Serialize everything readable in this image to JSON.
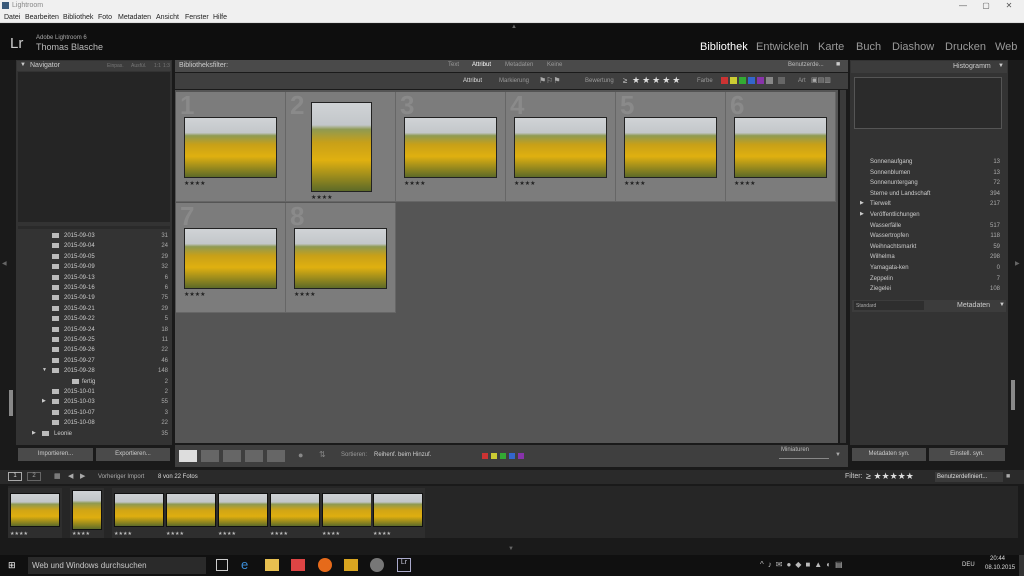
{
  "window": {
    "title": "Lightroom",
    "minimize": "—",
    "maximize": "▢",
    "close": "✕"
  },
  "menu": [
    "Datei",
    "Bearbeiten",
    "Bibliothek",
    "Foto",
    "Metadaten",
    "Ansicht",
    "Fenster",
    "Hilfe"
  ],
  "identity": {
    "product": "Adobe Lightroom 6",
    "user": "Thomas Blasche",
    "logo": "Lr"
  },
  "modules": [
    "Bibliothek",
    "Entwickeln",
    "Karte",
    "Buch",
    "Diashow",
    "Drucken",
    "Web"
  ],
  "navigator": {
    "title": "Navigator",
    "options": [
      "Einpas.",
      "Ausfül.",
      "1:1",
      "1:3"
    ]
  },
  "folders": [
    {
      "name": "2015-09-03",
      "count": "31"
    },
    {
      "name": "2015-09-04",
      "count": "24"
    },
    {
      "name": "2015-09-05",
      "count": "29"
    },
    {
      "name": "2015-09-09",
      "count": "32"
    },
    {
      "name": "2015-09-13",
      "count": "6"
    },
    {
      "name": "2015-09-16",
      "count": "6"
    },
    {
      "name": "2015-09-19",
      "count": "75"
    },
    {
      "name": "2015-09-21",
      "count": "29"
    },
    {
      "name": "2015-09-22",
      "count": "5"
    },
    {
      "name": "2015-09-24",
      "count": "18"
    },
    {
      "name": "2015-09-25",
      "count": "11"
    },
    {
      "name": "2015-09-26",
      "count": "22"
    },
    {
      "name": "2015-09-27",
      "count": "46"
    },
    {
      "name": "2015-09-28",
      "count": "148"
    },
    {
      "name": "fertig",
      "count": "2"
    },
    {
      "name": "2015-10-01",
      "count": "2"
    },
    {
      "name": "2015-10-03",
      "count": "55"
    },
    {
      "name": "2015-10-07",
      "count": "3"
    },
    {
      "name": "2015-10-08",
      "count": "22"
    },
    {
      "name": "Leonie",
      "count": "35"
    }
  ],
  "left_buttons": {
    "import": "Importieren...",
    "export": "Exportieren..."
  },
  "filterbar": {
    "label": "Bibliotheksfilter:",
    "tabs": [
      "Text",
      "Attribut",
      "Metadaten",
      "Keine"
    ],
    "preset": "Benutzerde...",
    "attr_label": "Attribut",
    "markierung": "Markierung",
    "bewertung": "Bewertung",
    "rating_op": "≥",
    "farbe": "Farbe",
    "art": "Art"
  },
  "grid": {
    "cells": [
      {
        "n": "1",
        "stars": "★★★★"
      },
      {
        "n": "2",
        "stars": "★★★★"
      },
      {
        "n": "3",
        "stars": "★★★★"
      },
      {
        "n": "4",
        "stars": "★★★★"
      },
      {
        "n": "5",
        "stars": "★★★★"
      },
      {
        "n": "6",
        "stars": "★★★★"
      },
      {
        "n": "7",
        "stars": "★★★★"
      },
      {
        "n": "8",
        "stars": "★★★★"
      }
    ]
  },
  "toolbar": {
    "sort_label": "Sortieren:",
    "sort_value": "Reihenf. beim Hinzuf.",
    "thumb_label": "Miniaturen"
  },
  "histogram": {
    "title": "Histogramm"
  },
  "keywords": [
    {
      "name": "Sonnenaufgang",
      "count": "13"
    },
    {
      "name": "Sonnenblumen",
      "count": "13"
    },
    {
      "name": "Sonnenuntergang",
      "count": "72"
    },
    {
      "name": "Sterne und Landschaft",
      "count": "394"
    },
    {
      "name": "Tierwelt",
      "count": "217"
    },
    {
      "name": "Veröffentlichungen",
      "count": ""
    },
    {
      "name": "Wasserfälle",
      "count": "517"
    },
    {
      "name": "Wassertropfen",
      "count": "118"
    },
    {
      "name": "Weihnachtsmarkt",
      "count": "59"
    },
    {
      "name": "Wilhelma",
      "count": "298"
    },
    {
      "name": "Yamagata-ken",
      "count": "0"
    },
    {
      "name": "Zeppelin",
      "count": "7"
    },
    {
      "name": "Ziegelei",
      "count": "108"
    }
  ],
  "metadata": {
    "preset": "Standard",
    "title": "Metadaten"
  },
  "right_buttons": {
    "meta_sync": "Metadaten syn.",
    "settings_sync": "Einstell. syn."
  },
  "filmstrip": {
    "source": "Vorheriger Import",
    "count": "8 von 22 Fotos",
    "filter_label": "Filter:",
    "filter_stars": "≥ ★★★★★",
    "filter_preset": "Benutzerdefiniert..."
  },
  "taskbar": {
    "search": "Web und Windows durchsuchen",
    "lang": "DEU",
    "time": "20:44",
    "date": "08.10.2015"
  },
  "colors": {
    "accent": "#ffffff",
    "panel": "#333333",
    "grid": "#7c7c7c"
  }
}
